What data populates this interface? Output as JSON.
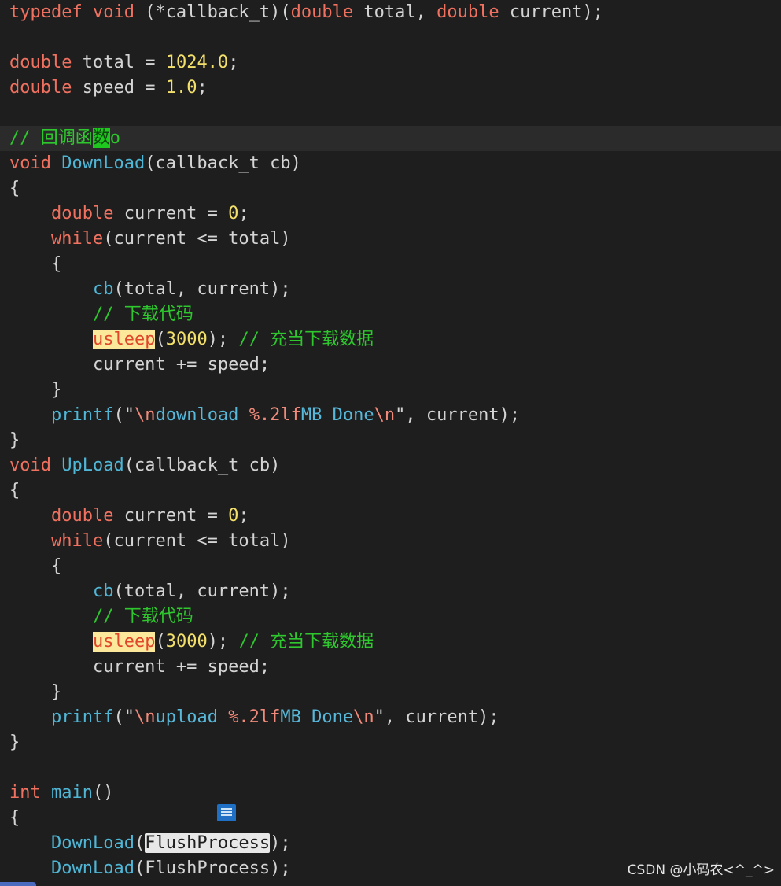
{
  "code": {
    "current_line": 5,
    "lines": [
      [
        {
          "t": "typedef",
          "c": "kw"
        },
        {
          "t": " "
        },
        {
          "t": "void",
          "c": "kw"
        },
        {
          "t": " (*callback_t)("
        },
        {
          "t": "double",
          "c": "kw"
        },
        {
          "t": " total, "
        },
        {
          "t": "double",
          "c": "kw"
        },
        {
          "t": " current);"
        }
      ],
      [],
      [
        {
          "t": "double",
          "c": "kw"
        },
        {
          "t": " total = "
        },
        {
          "t": "1024.0",
          "c": "num"
        },
        {
          "t": ";"
        }
      ],
      [
        {
          "t": "double",
          "c": "kw"
        },
        {
          "t": " speed = "
        },
        {
          "t": "1.0",
          "c": "num"
        },
        {
          "t": ";"
        }
      ],
      [],
      [
        {
          "t": "// 回调函",
          "c": "cm"
        },
        {
          "t": "数",
          "c": "hl-green"
        },
        {
          "t": "o",
          "c": "cm"
        }
      ],
      [
        {
          "t": "void",
          "c": "kw"
        },
        {
          "t": " "
        },
        {
          "t": "DownLoad",
          "c": "fn"
        },
        {
          "t": "(callback_t cb)"
        }
      ],
      [
        {
          "t": "{"
        }
      ],
      [
        {
          "t": "    "
        },
        {
          "t": "double",
          "c": "kw"
        },
        {
          "t": " current = "
        },
        {
          "t": "0",
          "c": "num"
        },
        {
          "t": ";"
        }
      ],
      [
        {
          "t": "    "
        },
        {
          "t": "while",
          "c": "kw"
        },
        {
          "t": "(current <= total)"
        }
      ],
      [
        {
          "t": "    {"
        }
      ],
      [
        {
          "t": "        "
        },
        {
          "t": "cb",
          "c": "fn"
        },
        {
          "t": "(total, current);"
        }
      ],
      [
        {
          "t": "        "
        },
        {
          "t": "// 下载代码",
          "c": "cm"
        }
      ],
      [
        {
          "t": "        "
        },
        {
          "t": "usleep",
          "c": "hl-yellow"
        },
        {
          "t": "("
        },
        {
          "t": "3000",
          "c": "num"
        },
        {
          "t": "); "
        },
        {
          "t": "// 充当下载数据",
          "c": "cm"
        }
      ],
      [
        {
          "t": "        current += speed;"
        }
      ],
      [
        {
          "t": "    }"
        }
      ],
      [
        {
          "t": "    "
        },
        {
          "t": "printf",
          "c": "fn"
        },
        {
          "t": "(\""
        },
        {
          "t": "\\n",
          "c": "esc"
        },
        {
          "t": "download ",
          "c": "str"
        },
        {
          "t": "%.2lf",
          "c": "fmt"
        },
        {
          "t": "MB Done",
          "c": "str"
        },
        {
          "t": "\\n",
          "c": "esc"
        },
        {
          "t": "\", current);"
        }
      ],
      [
        {
          "t": "}"
        }
      ],
      [
        {
          "t": "void",
          "c": "kw"
        },
        {
          "t": " "
        },
        {
          "t": "UpLoad",
          "c": "fn"
        },
        {
          "t": "(callback_t cb)"
        }
      ],
      [
        {
          "t": "{"
        }
      ],
      [
        {
          "t": "    "
        },
        {
          "t": "double",
          "c": "kw"
        },
        {
          "t": " current = "
        },
        {
          "t": "0",
          "c": "num"
        },
        {
          "t": ";"
        }
      ],
      [
        {
          "t": "    "
        },
        {
          "t": "while",
          "c": "kw"
        },
        {
          "t": "(current <= total)"
        }
      ],
      [
        {
          "t": "    {"
        }
      ],
      [
        {
          "t": "        "
        },
        {
          "t": "cb",
          "c": "fn"
        },
        {
          "t": "(total, current);"
        }
      ],
      [
        {
          "t": "        "
        },
        {
          "t": "// 下载代码",
          "c": "cm"
        }
      ],
      [
        {
          "t": "        "
        },
        {
          "t": "usleep",
          "c": "hl-yellow"
        },
        {
          "t": "("
        },
        {
          "t": "3000",
          "c": "num"
        },
        {
          "t": "); "
        },
        {
          "t": "// 充当下载数据",
          "c": "cm"
        }
      ],
      [
        {
          "t": "        current += speed;"
        }
      ],
      [
        {
          "t": "    }"
        }
      ],
      [
        {
          "t": "    "
        },
        {
          "t": "printf",
          "c": "fn"
        },
        {
          "t": "(\""
        },
        {
          "t": "\\n",
          "c": "esc"
        },
        {
          "t": "upload ",
          "c": "str"
        },
        {
          "t": "%.2lf",
          "c": "fmt"
        },
        {
          "t": "MB Done",
          "c": "str"
        },
        {
          "t": "\\n",
          "c": "esc"
        },
        {
          "t": "\", current);"
        }
      ],
      [
        {
          "t": "}"
        }
      ],
      [],
      [
        {
          "t": "int",
          "c": "kw"
        },
        {
          "t": " "
        },
        {
          "t": "main",
          "c": "fn"
        },
        {
          "t": "()"
        }
      ],
      [
        {
          "t": "{"
        }
      ],
      [
        {
          "t": "    "
        },
        {
          "t": "DownLoad",
          "c": "fn"
        },
        {
          "t": "("
        },
        {
          "t": "FlushProcess",
          "c": "hl-sel"
        },
        {
          "t": ");"
        }
      ],
      [
        {
          "t": "    "
        },
        {
          "t": "DownLoad",
          "c": "fn"
        },
        {
          "t": "(FlushProcess);"
        }
      ]
    ]
  },
  "icons": {
    "note": "note-icon"
  },
  "watermark": {
    "text": "CSDN @小码农<^_^>"
  },
  "colors": {
    "background": "#1e1e1e",
    "keyword": "#f0715f",
    "function": "#4fb6d6",
    "number": "#f3e06a",
    "comment": "#2ec82e",
    "highlight_yellow": "#fbe89a",
    "highlight_green": "#1ec81e"
  }
}
